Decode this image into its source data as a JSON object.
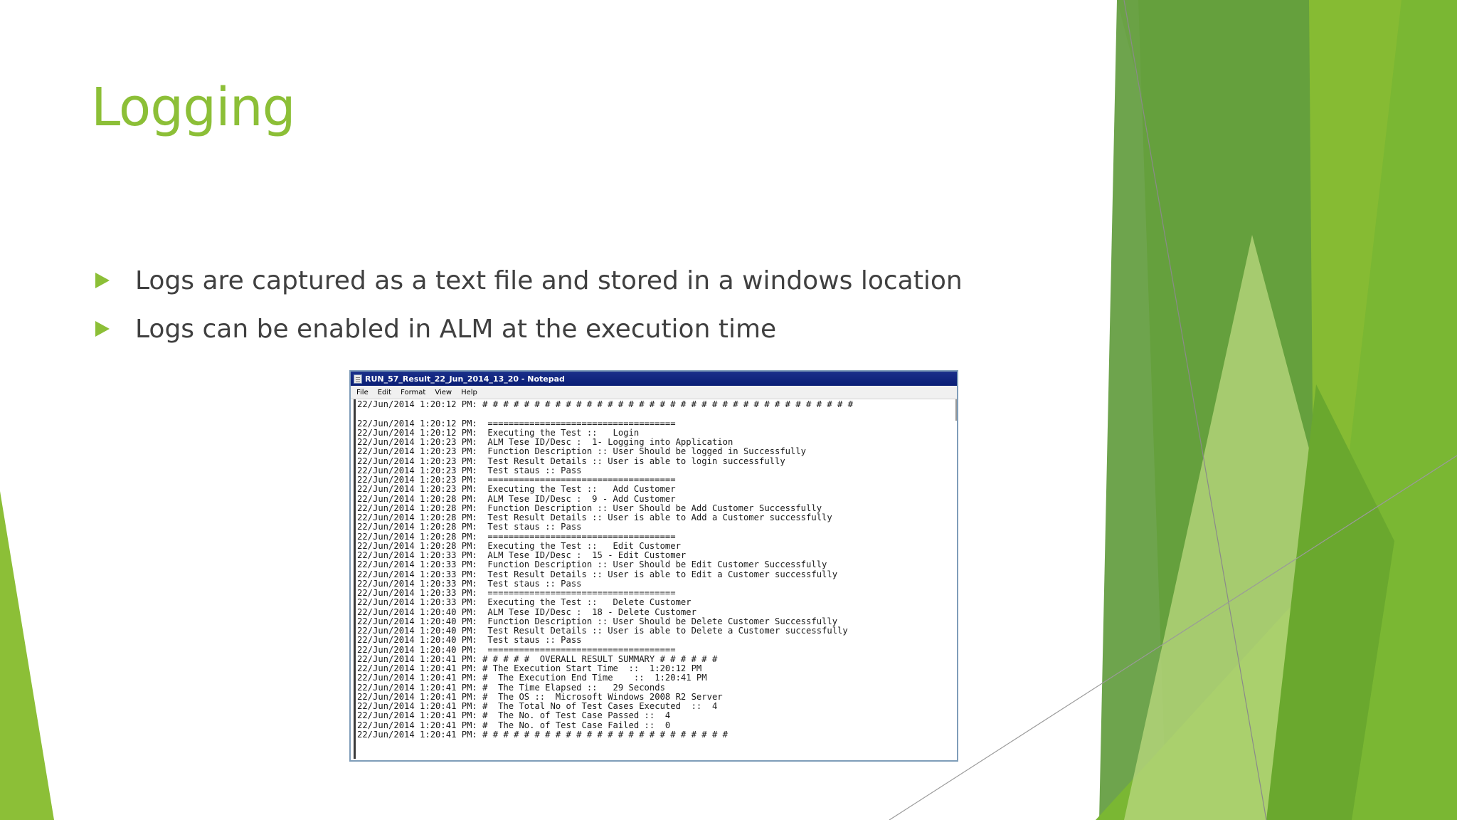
{
  "slide": {
    "title": "Logging",
    "bullets": [
      "Logs are captured as a text file and stored in a windows location",
      "Logs can be enabled in ALM at the execution time"
    ],
    "colors": {
      "accent": "#8cbf37",
      "text": "#404040",
      "green_dark": "#5e9a3a",
      "green_mid": "#7ab733",
      "green_light": "#c6df98"
    }
  },
  "notepad": {
    "window_title": "RUN_57_Result_22_Jun_2014_13_20 - Notepad",
    "icon": "notepad-icon",
    "menu": [
      "File",
      "Edit",
      "Format",
      "View",
      "Help"
    ],
    "lines": [
      "22/Jun/2014 1:20:12 PM: # # # # # # # # # # # # # # # # # # # # # # # # # # # # # # # # # # # #",
      "",
      "22/Jun/2014 1:20:12 PM:  ====================================",
      "22/Jun/2014 1:20:12 PM:  Executing the Test ::   Login",
      "22/Jun/2014 1:20:23 PM:  ALM Tese ID/Desc :  1- Logging into Application",
      "22/Jun/2014 1:20:23 PM:  Function Description :: User Should be logged in Successfully",
      "22/Jun/2014 1:20:23 PM:  Test Result Details :: User is able to login successfully",
      "22/Jun/2014 1:20:23 PM:  Test staus :: Pass",
      "22/Jun/2014 1:20:23 PM:  ====================================",
      "22/Jun/2014 1:20:23 PM:  Executing the Test ::   Add Customer",
      "22/Jun/2014 1:20:28 PM:  ALM Tese ID/Desc :  9 - Add Customer",
      "22/Jun/2014 1:20:28 PM:  Function Description :: User Should be Add Customer Successfully",
      "22/Jun/2014 1:20:28 PM:  Test Result Details :: User is able to Add a Customer successfully",
      "22/Jun/2014 1:20:28 PM:  Test staus :: Pass",
      "22/Jun/2014 1:20:28 PM:  ====================================",
      "22/Jun/2014 1:20:28 PM:  Executing the Test ::   Edit Customer",
      "22/Jun/2014 1:20:33 PM:  ALM Tese ID/Desc :  15 - Edit Customer",
      "22/Jun/2014 1:20:33 PM:  Function Description :: User Should be Edit Customer Successfully",
      "22/Jun/2014 1:20:33 PM:  Test Result Details :: User is able to Edit a Customer successfully",
      "22/Jun/2014 1:20:33 PM:  Test staus :: Pass",
      "22/Jun/2014 1:20:33 PM:  ====================================",
      "22/Jun/2014 1:20:33 PM:  Executing the Test ::   Delete Customer",
      "22/Jun/2014 1:20:40 PM:  ALM Tese ID/Desc :  18 - Delete Customer",
      "22/Jun/2014 1:20:40 PM:  Function Description :: User Should be Delete Customer Successfully",
      "22/Jun/2014 1:20:40 PM:  Test Result Details :: User is able to Delete a Customer successfully",
      "22/Jun/2014 1:20:40 PM:  Test staus :: Pass",
      "22/Jun/2014 1:20:40 PM:  ====================================",
      "22/Jun/2014 1:20:41 PM: # # # # #  OVERALL RESULT SUMMARY # # # # # #",
      "22/Jun/2014 1:20:41 PM: # The Execution Start Time  ::  1:20:12 PM",
      "22/Jun/2014 1:20:41 PM: #  The Execution End Time    ::  1:20:41 PM",
      "22/Jun/2014 1:20:41 PM: #  The Time Elapsed ::   29 Seconds",
      "22/Jun/2014 1:20:41 PM: #  The OS ::  Microsoft Windows 2008 R2 Server",
      "22/Jun/2014 1:20:41 PM: #  The Total No of Test Cases Executed  ::  4",
      "22/Jun/2014 1:20:41 PM: #  The No. of Test Case Passed ::  4",
      "22/Jun/2014 1:20:41 PM: #  The No. of Test Case Failed ::  0",
      "22/Jun/2014 1:20:41 PM: # # # # # # # # # # # # # # # # # # # # # # # #"
    ]
  }
}
